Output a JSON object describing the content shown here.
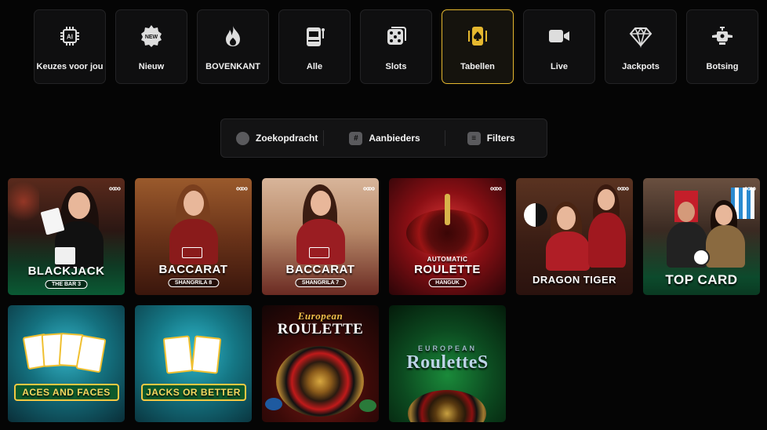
{
  "categories": [
    {
      "label": "Keuzes voor jou",
      "icon": "ai-chip-icon",
      "active": false
    },
    {
      "label": "Nieuw",
      "icon": "new-badge-icon",
      "active": false
    },
    {
      "label": "BOVENKANT",
      "icon": "flame-icon",
      "active": false
    },
    {
      "label": "Alle",
      "icon": "slot-machine-icon",
      "active": false
    },
    {
      "label": "Slots",
      "icon": "dice-icon",
      "active": false
    },
    {
      "label": "Tabellen",
      "icon": "card-spade-icon",
      "active": true
    },
    {
      "label": "Live",
      "icon": "video-camera-icon",
      "active": false
    },
    {
      "label": "Jackpots",
      "icon": "diamond-icon",
      "active": false
    },
    {
      "label": "Botsing",
      "icon": "plane-icon",
      "active": false
    }
  ],
  "search": {
    "search_label": "Zoekopdracht",
    "providers_label": "Aanbieders",
    "filters_label": "Filters"
  },
  "games": [
    {
      "title": "BLACKJACK",
      "subtitle": "THE BAR 3",
      "badge": "∞∞"
    },
    {
      "title": "BACCARAT",
      "subtitle": "SHANGRILA 8",
      "badge": "∞∞"
    },
    {
      "title": "BACCARAT",
      "subtitle": "SHANGRILA 7",
      "badge": "∞∞"
    },
    {
      "title_top": "AUTOMATIC",
      "title": "ROULETTE",
      "subtitle": "HANGUK",
      "badge": "∞∞"
    },
    {
      "title": "DRAGON TIGER",
      "badge": "∞∞"
    },
    {
      "title": "TOP CARD",
      "badge": "∞∞"
    },
    {
      "title": "ACES AND FACES"
    },
    {
      "title": "JACKS OR BETTER"
    },
    {
      "title_top": "European",
      "title": "ROULETTE"
    },
    {
      "title_top": "EUROPEAN",
      "title": "RouletteS"
    }
  ],
  "colors": {
    "accent": "#e5b82f",
    "background": "#050505"
  }
}
